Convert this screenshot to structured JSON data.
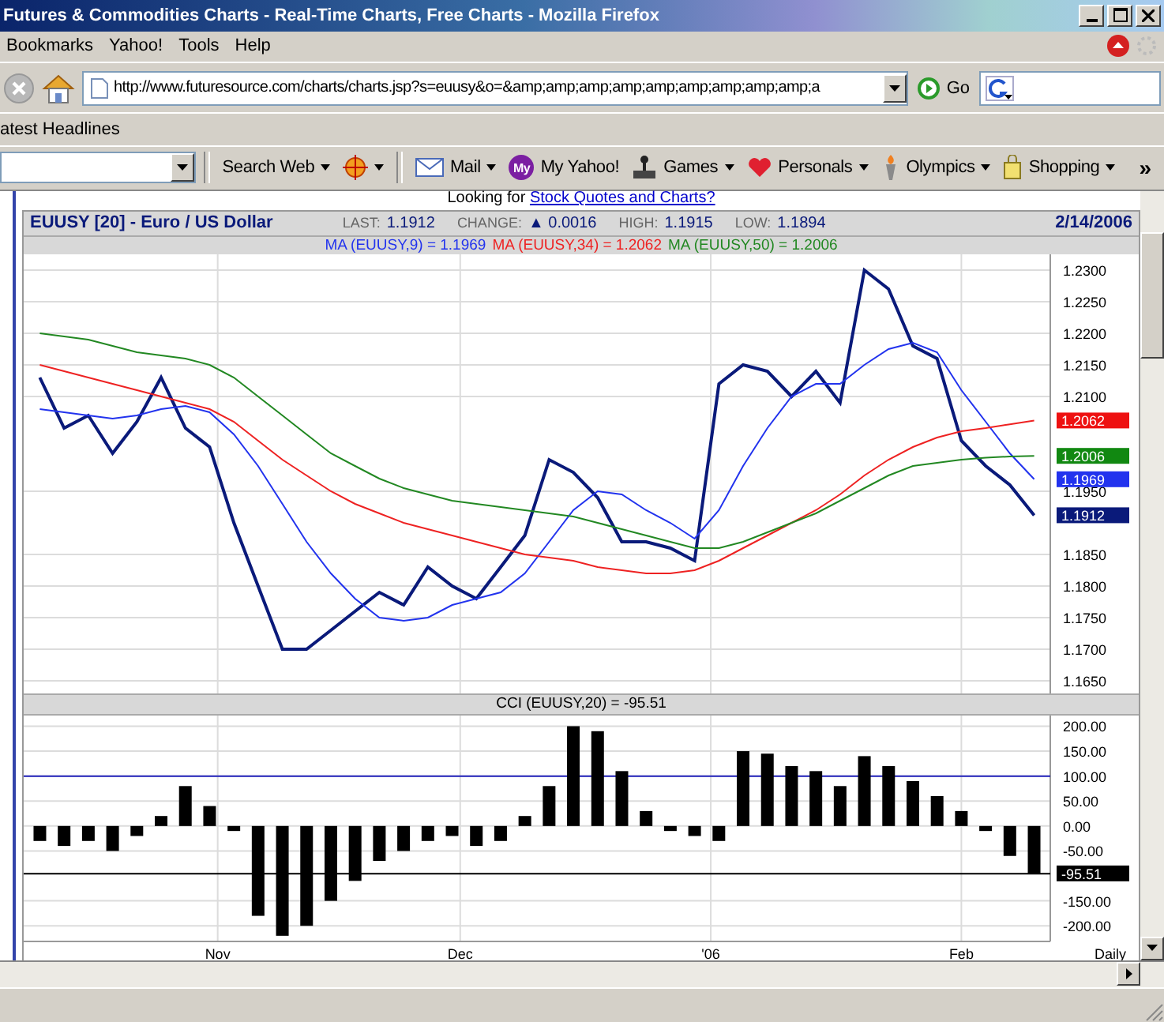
{
  "window": {
    "title": "Futures & Commodities Charts - Real-Time Charts, Free Charts - Mozilla Firefox"
  },
  "menu": [
    "Bookmarks",
    "Yahoo!",
    "Tools",
    "Help"
  ],
  "nav": {
    "url": "http://www.futuresource.com/charts/charts.jsp?s=euusy&o=&amp;amp;amp;amp;amp;amp;amp;amp;amp;a",
    "go": "Go"
  },
  "bookmarks": [
    "atest Headlines"
  ],
  "yahoo_toolbar": [
    {
      "label": "Search Web",
      "dropdown": true
    },
    {
      "dropdown": true
    },
    {
      "label": "Mail",
      "dropdown": true
    },
    {
      "label": "My Yahoo!",
      "dropdown": false,
      "icon_text": "My"
    },
    {
      "label": "Games",
      "dropdown": true
    },
    {
      "label": "Personals",
      "dropdown": true
    },
    {
      "label": "Olympics",
      "dropdown": true
    },
    {
      "label": "Shopping",
      "dropdown": true
    }
  ],
  "more": "»",
  "teaser": {
    "text": "Looking for",
    "link": "Stock Quotes and Charts?"
  },
  "header": {
    "stats": [
      {
        "label": "LAST:",
        "value": "1.1912"
      },
      {
        "label": "CHANGE:",
        "value": "▲ 0.0016"
      },
      {
        "label": "HIGH:",
        "value": "1.1915"
      },
      {
        "label": "LOW:",
        "value": "1.1894"
      }
    ],
    "date": "2/14/2006"
  },
  "price_chart": {
    "chart_data": {
      "type": "line",
      "title": "EUUSY [20] - Euro / US Dollar",
      "grid": true,
      "series": [
        {
          "color": "#0a1a7a",
          "values": [
            1.213,
            1.205,
            1.207,
            1.201,
            1.206,
            1.213,
            1.205,
            1.202,
            1.19,
            1.18,
            1.17,
            1.17,
            1.173,
            1.176,
            1.179,
            1.177,
            1.183,
            1.18,
            1.178,
            1.183,
            1.188,
            1.2,
            1.198,
            1.194,
            1.187,
            1.187,
            1.186,
            1.184,
            1.212,
            1.215,
            1.214,
            1.21,
            1.214,
            1.209,
            1.23,
            1.227,
            1.218,
            1.216,
            1.203,
            1.199,
            1.196,
            1.1912
          ]
        },
        {
          "name": "MA (EUUSY,9) = 1.1969",
          "color": "#2233ee",
          "values": [
            1.208,
            1.2075,
            1.207,
            1.2065,
            1.207,
            1.208,
            1.2085,
            1.2075,
            1.204,
            1.199,
            1.193,
            1.187,
            1.182,
            1.178,
            1.175,
            1.1745,
            1.175,
            1.177,
            1.178,
            1.179,
            1.182,
            1.187,
            1.192,
            1.195,
            1.1945,
            1.192,
            1.19,
            1.1875,
            1.192,
            1.199,
            1.205,
            1.21,
            1.212,
            1.212,
            1.215,
            1.2175,
            1.2185,
            1.217,
            1.211,
            1.206,
            1.201,
            1.1969
          ]
        },
        {
          "name": "MA (EUUSY,34) = 1.2062",
          "color": "#ee2222",
          "values": [
            1.215,
            1.214,
            1.213,
            1.212,
            1.211,
            1.21,
            1.209,
            1.208,
            1.206,
            1.203,
            1.2,
            1.1975,
            1.195,
            1.193,
            1.1915,
            1.19,
            1.189,
            1.188,
            1.187,
            1.186,
            1.185,
            1.1845,
            1.184,
            1.183,
            1.1825,
            1.182,
            1.182,
            1.1825,
            1.184,
            1.186,
            1.188,
            1.19,
            1.192,
            1.1945,
            1.1975,
            1.2,
            1.202,
            1.2035,
            1.2045,
            1.205,
            1.2056,
            1.2062
          ]
        },
        {
          "name": "MA (EUUSY,50) = 1.2006",
          "color": "#228822",
          "values": [
            1.22,
            1.2195,
            1.219,
            1.218,
            1.217,
            1.2165,
            1.216,
            1.215,
            1.213,
            1.21,
            1.207,
            1.204,
            1.201,
            1.199,
            1.197,
            1.1955,
            1.1945,
            1.1935,
            1.193,
            1.1925,
            1.192,
            1.1915,
            1.191,
            1.19,
            1.189,
            1.188,
            1.187,
            1.186,
            1.186,
            1.187,
            1.1885,
            1.19,
            1.1915,
            1.1935,
            1.1955,
            1.1975,
            1.199,
            1.1995,
            1.2,
            1.2003,
            1.2005,
            1.2006
          ]
        }
      ],
      "ylim": [
        1.165,
        1.23
      ],
      "yticks": [
        {
          "value": 1.23,
          "label": "1.2300"
        },
        {
          "value": 1.225,
          "label": "1.2250"
        },
        {
          "value": 1.22,
          "label": "1.2200"
        },
        {
          "value": 1.215,
          "label": "1.2150"
        },
        {
          "value": 1.21,
          "label": "1.2100"
        },
        {
          "value": 1.195,
          "label": "1.1950"
        },
        {
          "value": 1.185,
          "label": "1.1850"
        },
        {
          "value": 1.18,
          "label": "1.1800"
        },
        {
          "value": 1.175,
          "label": "1.1750"
        },
        {
          "value": 1.17,
          "label": "1.1700"
        },
        {
          "value": 1.165,
          "label": "1.1650"
        }
      ]
    },
    "badges": [
      {
        "text": "1.2062",
        "color": "#ee1111"
      },
      {
        "text": "1.2006",
        "color": "#118811"
      },
      {
        "text": "1.1969",
        "color": "#2233ee"
      },
      {
        "text": "1.1912",
        "color": "#0a1a7a"
      }
    ]
  },
  "cci_chart": {
    "chart_data": {
      "type": "bar",
      "title": "CCI (EUUSY,20) = -95.51",
      "grid": true,
      "x": [
        "2005-10-10",
        "2005-10-13",
        "2005-10-16",
        "2005-10-19",
        "2005-10-22",
        "2005-10-25",
        "2005-10-28",
        "2005-10-31",
        "2005-11-03",
        "2005-11-06",
        "2005-11-09",
        "2005-11-12",
        "2005-11-15",
        "2005-11-18",
        "2005-11-21",
        "2005-11-24",
        "2005-11-27",
        "2005-11-30",
        "2005-12-03",
        "2005-12-06",
        "2005-12-09",
        "2005-12-12",
        "2005-12-15",
        "2005-12-18",
        "2005-12-21",
        "2005-12-24",
        "2005-12-27",
        "2005-12-30",
        "2006-01-02",
        "2006-01-05",
        "2006-01-08",
        "2006-01-11",
        "2006-01-14",
        "2006-01-17",
        "2006-01-20",
        "2006-01-23",
        "2006-01-26",
        "2006-01-29",
        "2006-02-01",
        "2006-02-04",
        "2006-02-07",
        "2006-02-10"
      ],
      "values": [
        -30,
        -40,
        -30,
        -50,
        -20,
        20,
        80,
        40,
        -10,
        -180,
        -220,
        -200,
        -150,
        -110,
        -70,
        -50,
        -30,
        -20,
        -40,
        -30,
        20,
        80,
        200,
        190,
        110,
        30,
        -10,
        -20,
        -30,
        150,
        145,
        120,
        110,
        80,
        140,
        120,
        90,
        60,
        30,
        -10,
        -60,
        -95
      ],
      "ylim": [
        -225,
        215
      ],
      "xlim": [
        "2005-10-08",
        "2006-02-12"
      ],
      "xticks": [
        {
          "value": "2005-11-01",
          "label": "Nov"
        },
        {
          "value": "2005-12-01",
          "label": "Dec"
        },
        {
          "value": "2006-01-01",
          "label": "'06"
        },
        {
          "value": "2006-02-01",
          "label": "Feb"
        }
      ],
      "yticks": [
        {
          "value": 200,
          "label": "200.00"
        },
        {
          "value": 150,
          "label": "150.00"
        },
        {
          "value": 100,
          "label": "100.00"
        },
        {
          "value": 50,
          "label": "50.00"
        },
        {
          "value": 0,
          "label": "0.00"
        },
        {
          "value": -50,
          "label": "-50.00"
        },
        {
          "value": -150,
          "label": "-150.00"
        },
        {
          "value": -200,
          "label": "-200.00"
        }
      ],
      "ref_lines": [
        {
          "axis": "y",
          "value": 100,
          "color": "#2222bb"
        },
        {
          "axis": "y",
          "value": -95.51,
          "color": "#000000"
        }
      ]
    },
    "badges": [
      {
        "text": "-95.51",
        "color": "#000000"
      }
    ]
  },
  "period": "Daily"
}
